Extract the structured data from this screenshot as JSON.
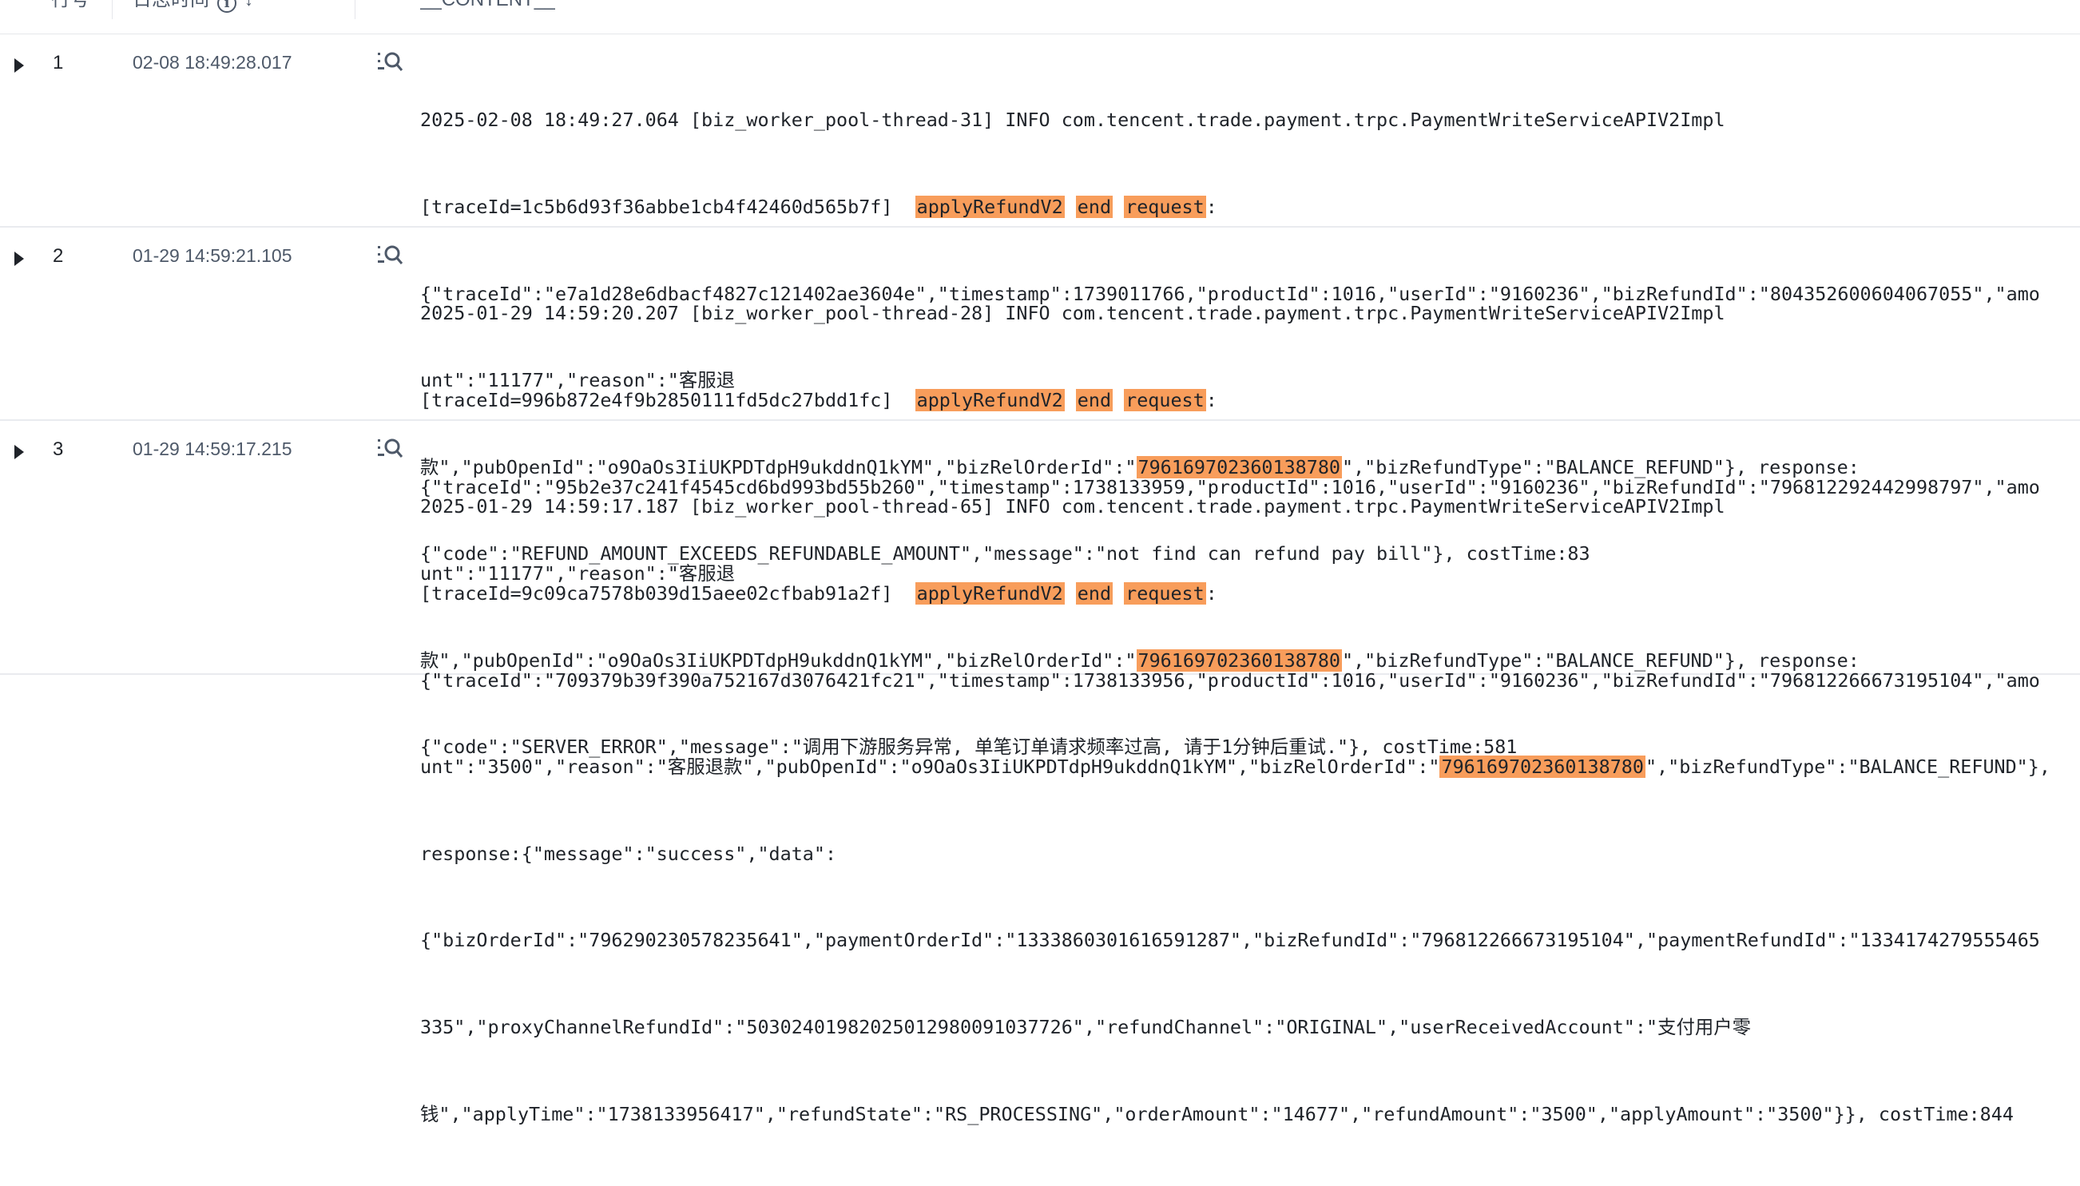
{
  "header": {
    "col_no": "行号",
    "col_time": "日志时间",
    "col_content": "__CONTENT__"
  },
  "rows": [
    {
      "no": "1",
      "time": "02-08 18:49:28.017",
      "lines": [
        "2025-02-08 18:49:27.064 [biz_worker_pool-thread-31] INFO com.tencent.trade.payment.trpc.PaymentWriteServiceAPIV2Impl",
        "[traceId=1c5b6d93f36abbe1cb4f42460d565b7f]  ",
        "{\"traceId\":\"e7a1d28e6dbacf4827c121402ae3604e\",\"timestamp\":1739011766,\"productId\":1016,\"userId\":\"9160236\",\"bizRefundId\":\"804352600604067055\",\"amo",
        "unt\":\"11177\",\"reason\":\"客服退",
        "款\",\"pubOpenId\":\"o9OaOs3IiUKPDTdpH9ukddnQ1kYM\",\"bizRelOrderId\":\"",
        "{\"code\":\"REFUND_AMOUNT_EXCEEDS_REFUNDABLE_AMOUNT\",\"message\":\"not find can refund pay bill\"}, costTime:83"
      ],
      "tail": "\",\"bizRefundType\":\"BALANCE_REFUND\"}, response:"
    },
    {
      "no": "2",
      "time": "01-29 14:59:21.105",
      "lines": [
        "2025-01-29 14:59:20.207 [biz_worker_pool-thread-28] INFO com.tencent.trade.payment.trpc.PaymentWriteServiceAPIV2Impl",
        "[traceId=996b872e4f9b2850111fd5dc27bdd1fc]  ",
        "{\"traceId\":\"95b2e37c241f4545cd6bd993bd55b260\",\"timestamp\":1738133959,\"productId\":1016,\"userId\":\"9160236\",\"bizRefundId\":\"796812292442998797\",\"amo",
        "unt\":\"11177\",\"reason\":\"客服退",
        "款\",\"pubOpenId\":\"o9OaOs3IiUKPDTdpH9ukddnQ1kYM\",\"bizRelOrderId\":\"",
        "{\"code\":\"SERVER_ERROR\",\"message\":\"调用下游服务异常, 单笔订单请求频率过高, 请于1分钟后重试.\"}, costTime:581"
      ],
      "tail": "\",\"bizRefundType\":\"BALANCE_REFUND\"}, response:"
    },
    {
      "no": "3",
      "time": "01-29 14:59:17.215",
      "lines": [
        "2025-01-29 14:59:17.187 [biz_worker_pool-thread-65] INFO com.tencent.trade.payment.trpc.PaymentWriteServiceAPIV2Impl",
        "[traceId=9c09ca7578b039d15aee02cfbab91a2f]  ",
        "{\"traceId\":\"709379b39f390a752167d3076421fc21\",\"timestamp\":1738133956,\"productId\":1016,\"userId\":\"9160236\",\"bizRefundId\":\"796812266673195104\",\"amo",
        "unt\":\"3500\",\"reason\":\"客服退款\",\"pubOpenId\":\"o9OaOs3IiUKPDTdpH9ukddnQ1kYM\",\"bizRelOrderId\":\"",
        "response:{\"message\":\"success\",\"data\":",
        "{\"bizOrderId\":\"796290230578235641\",\"paymentOrderId\":\"1333860301616591287\",\"bizRefundId\":\"796812266673195104\",\"paymentRefundId\":\"1334174279555465",
        "335\",\"proxyChannelRefundId\":\"50302401982025012980091037726\",\"refundChannel\":\"ORIGINAL\",\"userReceivedAccount\":\"支付用户零",
        "钱\",\"applyTime\":\"1738133956417\",\"refundState\":\"RS_PROCESSING\",\"orderAmount\":\"14677\",\"refundAmount\":\"3500\",\"applyAmount\":\"3500\"}}, costTime:844"
      ],
      "tail": "\",\"bizRefundType\":\"BALANCE_REFUND\"},"
    }
  ],
  "highlights": {
    "method": "applyRefundV2",
    "end": "end",
    "request": "request",
    "order_id": "796169702360138780"
  },
  "colors": {
    "highlight": "#f89d5b",
    "divider": "#e9ebef",
    "text": "#1f2329",
    "muted": "#4e5969"
  }
}
